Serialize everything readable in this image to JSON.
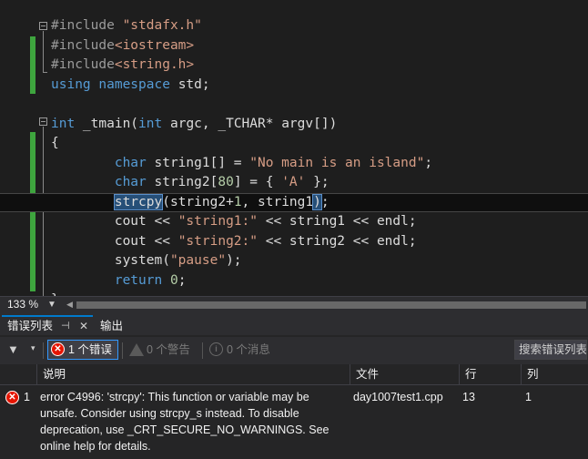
{
  "editor": {
    "lines": [
      {
        "segments": [
          {
            "t": "#include ",
            "c": "pp"
          },
          {
            "t": "\"stdafx.h\"",
            "c": "str"
          }
        ]
      },
      {
        "segments": [
          {
            "t": "#include",
            "c": "pp"
          },
          {
            "t": "<iostream>",
            "c": "str"
          }
        ]
      },
      {
        "segments": [
          {
            "t": "#include",
            "c": "pp"
          },
          {
            "t": "<string.h>",
            "c": "str"
          }
        ]
      },
      {
        "segments": [
          {
            "t": "using",
            "c": "kw"
          },
          {
            "t": " ",
            "c": ""
          },
          {
            "t": "namespace",
            "c": "kw"
          },
          {
            "t": " std;",
            "c": ""
          }
        ]
      },
      {
        "segments": []
      },
      {
        "segments": [
          {
            "t": "int",
            "c": "kw"
          },
          {
            "t": " _tmain(",
            "c": ""
          },
          {
            "t": "int",
            "c": "kw"
          },
          {
            "t": " argc, _TCHAR* argv[])",
            "c": ""
          }
        ]
      },
      {
        "segments": [
          {
            "t": "{",
            "c": ""
          }
        ]
      },
      {
        "segments": [
          {
            "t": "        ",
            "c": ""
          },
          {
            "t": "char",
            "c": "kw"
          },
          {
            "t": " string1[] = ",
            "c": ""
          },
          {
            "t": "\"No main is an island\"",
            "c": "str"
          },
          {
            "t": ";",
            "c": ""
          }
        ]
      },
      {
        "segments": [
          {
            "t": "        ",
            "c": ""
          },
          {
            "t": "char",
            "c": "kw"
          },
          {
            "t": " string2[",
            "c": ""
          },
          {
            "t": "80",
            "c": "num"
          },
          {
            "t": "] = { ",
            "c": ""
          },
          {
            "t": "'A'",
            "c": "str"
          },
          {
            "t": " };",
            "c": ""
          }
        ]
      },
      {
        "segments": [
          {
            "t": "        ",
            "c": ""
          },
          {
            "t": "strcpy",
            "c": "hl"
          },
          {
            "t": "(string2+",
            "c": ""
          },
          {
            "t": "1",
            "c": "num"
          },
          {
            "t": ", string1",
            "c": ""
          },
          {
            "t": ")",
            "c": "hl"
          },
          {
            "t": ";",
            "c": ""
          }
        ]
      },
      {
        "segments": [
          {
            "t": "        cout << ",
            "c": ""
          },
          {
            "t": "\"string1:\"",
            "c": "str"
          },
          {
            "t": " << string1 << endl;",
            "c": ""
          }
        ]
      },
      {
        "segments": [
          {
            "t": "        cout << ",
            "c": ""
          },
          {
            "t": "\"string2:\"",
            "c": "str"
          },
          {
            "t": " << string2 << endl;",
            "c": ""
          }
        ]
      },
      {
        "segments": [
          {
            "t": "        system(",
            "c": ""
          },
          {
            "t": "\"pause\"",
            "c": "str"
          },
          {
            "t": ");",
            "c": ""
          }
        ]
      },
      {
        "segments": [
          {
            "t": "        ",
            "c": ""
          },
          {
            "t": "return",
            "c": "kw"
          },
          {
            "t": " ",
            "c": ""
          },
          {
            "t": "0",
            "c": "num"
          },
          {
            "t": ";",
            "c": ""
          }
        ]
      },
      {
        "segments": [
          {
            "t": "}",
            "c": ""
          }
        ]
      }
    ],
    "current_line_index": 9
  },
  "zoom": {
    "level": "133 %"
  },
  "panel": {
    "tab_error_list": "错误列表",
    "tab_output": "输出",
    "filter_errors": "1 个错误",
    "filter_warnings": "0 个警告",
    "filter_messages": "0 个消息",
    "search_placeholder": "搜索错误列表",
    "columns": {
      "description": "说明",
      "file": "文件",
      "line": "行",
      "column": "列"
    },
    "rows": [
      {
        "index": "1",
        "description": "error C4996: 'strcpy': This function or variable may be unsafe. Consider using strcpy_s instead. To disable deprecation, use _CRT_SECURE_NO_WARNINGS. See online help for details.",
        "file": "day1007test1.cpp",
        "line": "13",
        "column": "1"
      }
    ]
  }
}
